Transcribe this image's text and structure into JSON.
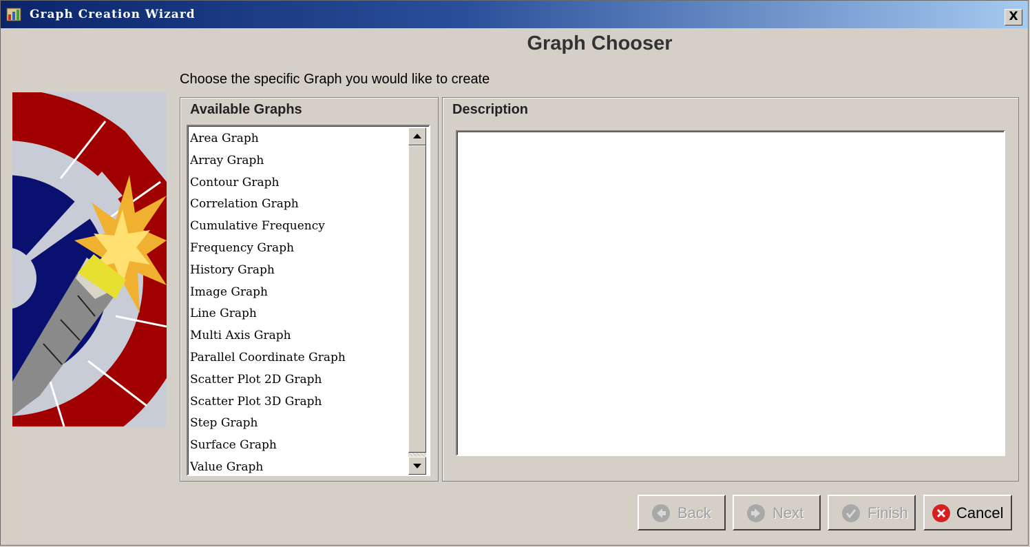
{
  "window": {
    "title": "Graph Creation Wizard",
    "close_label": "X"
  },
  "header": {
    "heading": "Graph Chooser",
    "instruction": "Choose the specific Graph you would like to create"
  },
  "available_graphs": {
    "title": "Available Graphs",
    "items": [
      "Area Graph",
      "Array Graph",
      "Contour Graph",
      "Correlation Graph",
      "Cumulative Frequency",
      "Frequency Graph",
      "History Graph",
      "Image Graph",
      "Line Graph",
      "Multi Axis Graph",
      "Parallel Coordinate Graph",
      "Scatter Plot 2D Graph",
      "Scatter Plot 3D Graph",
      "Step Graph",
      "Surface Graph",
      "Value Graph"
    ]
  },
  "description": {
    "title": "Description",
    "text": ""
  },
  "buttons": {
    "back": "Back",
    "next": "Next",
    "finish": "Finish",
    "cancel": "Cancel"
  },
  "icons": {
    "app": "wizard-app-icon",
    "back": "back-arrow-icon",
    "next": "next-arrow-icon",
    "finish": "checkmark-icon",
    "cancel": "cancel-x-icon"
  },
  "colors": {
    "titlebar_start": "#0a246a",
    "titlebar_end": "#a6caf0",
    "cancel_red": "#d42020",
    "art_red": "#a00000",
    "art_navy": "#0a1070"
  }
}
